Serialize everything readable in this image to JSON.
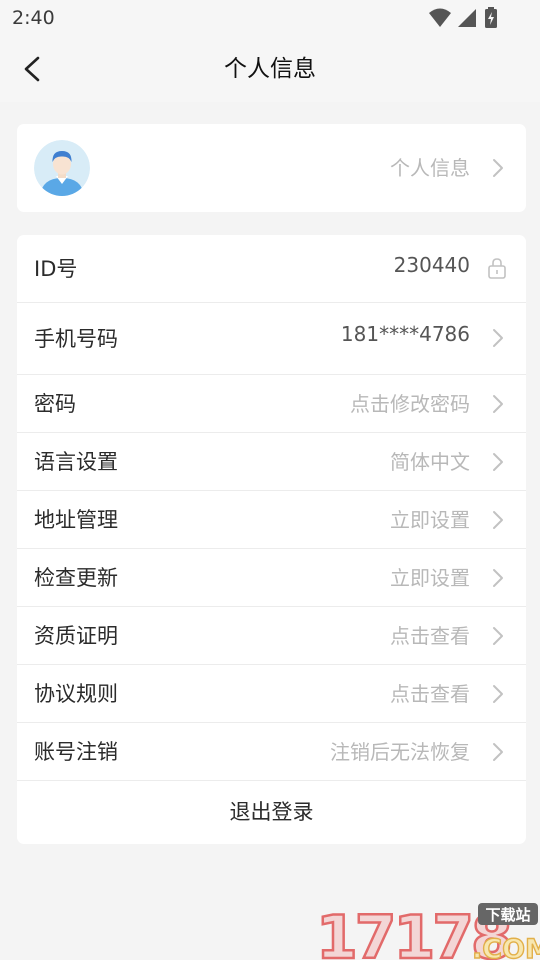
{
  "status_bar": {
    "time": "2:40"
  },
  "nav": {
    "title": "个人信息",
    "back_icon": "chevron-left-icon"
  },
  "profile": {
    "label": "个人信息"
  },
  "rows": [
    {
      "label": "ID号",
      "value": "230440",
      "icon": "lock-icon"
    },
    {
      "label": "手机号码",
      "value": "181****4786",
      "icon": "chevron-right-icon"
    },
    {
      "label": "密码",
      "value": "点击修改密码",
      "icon": "chevron-right-icon"
    },
    {
      "label": "语言设置",
      "value": "简体中文",
      "icon": "chevron-right-icon"
    },
    {
      "label": "地址管理",
      "value": "立即设置",
      "icon": "chevron-right-icon"
    },
    {
      "label": "检查更新",
      "value": "立即设置",
      "icon": "chevron-right-icon"
    },
    {
      "label": "资质证明",
      "value": "点击查看",
      "icon": "chevron-right-icon"
    },
    {
      "label": "协议规则",
      "value": "点击查看",
      "icon": "chevron-right-icon"
    },
    {
      "label": "账号注销",
      "value": "注销后无法恢复",
      "icon": "chevron-right-icon"
    }
  ],
  "logout_label": "退出登录",
  "watermark": {
    "number": "17178",
    "tag": "下载站",
    "domain": ".COM"
  },
  "colors": {
    "background": "#f4f4f4",
    "card": "#ffffff",
    "hint_text": "#b8b8b8",
    "avatar_bg": "#d8ecf7",
    "avatar_shirt": "#5aa8e6"
  }
}
